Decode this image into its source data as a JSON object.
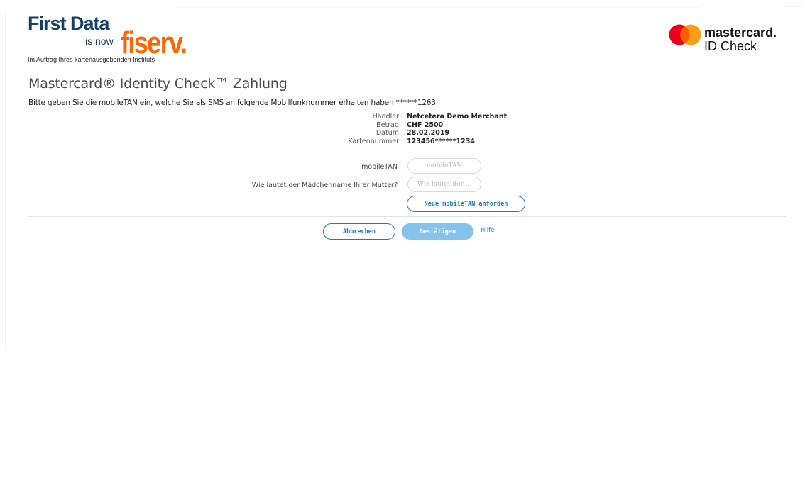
{
  "issuer": {
    "first_data": "First Data",
    "is_now": "is now",
    "fiserv": "fiserv.",
    "subtitle": "Im Auftrag Ihres kartenausgebenden Instituts"
  },
  "scheme": {
    "wordmark": "mastercard.",
    "product": "ID Check",
    "colors": {
      "left_circle": "#eb001b",
      "right_circle": "#f79e1b",
      "overlap": "#ff5f00"
    }
  },
  "page": {
    "title": "Mastercard® Identity Check™ Zahlung",
    "instruction": "Bitte geben Sie die mobileTAN ein, welche Sie als SMS an folgende Mobilfunknummer erhalten haben ******1263"
  },
  "transaction": [
    {
      "label": "Händler",
      "value": "Netcetera Demo Merchant"
    },
    {
      "label": "Betrag",
      "value": "CHF 2500"
    },
    {
      "label": "Datum",
      "value": "28.02.2019"
    },
    {
      "label": "Kartennummer",
      "value": "123456******1234"
    }
  ],
  "form": {
    "tan_label": "mobileTAN",
    "tan_placeholder": "mobileTAN",
    "tan_value": "",
    "question_label": "Wie lautet der Mädchenname Ihrer Mutter?",
    "question_placeholder": "Wie lautet der ...",
    "question_value": "",
    "resend_label": "Neue mobileTAN anforden"
  },
  "actions": {
    "cancel_label": "Abbrechen",
    "confirm_label": "Bestätigen",
    "help_label": "Hilfe"
  },
  "colors": {
    "accent": "#1f79c2",
    "confirm_disabled": "#83c3ec",
    "fiserv_orange": "#ff6600",
    "first_data_navy": "#173f61"
  }
}
